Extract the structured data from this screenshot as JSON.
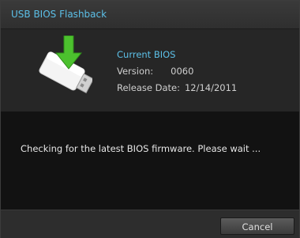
{
  "window": {
    "title": "USB BIOS Flashback"
  },
  "bios_info": {
    "heading": "Current BIOS",
    "version_label": "Version:",
    "version_value": "0060",
    "release_label": "Release Date:",
    "release_value": "12/14/2011"
  },
  "status": {
    "message": "Checking for the latest BIOS firmware. Please wait ..."
  },
  "footer": {
    "cancel_label": "Cancel"
  },
  "colors": {
    "accent": "#5cc0e8",
    "arrow": "#4cc12e"
  },
  "icons": {
    "usb": "usb-drive-download-icon"
  }
}
